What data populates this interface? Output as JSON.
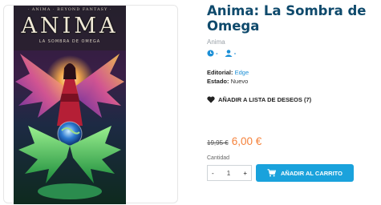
{
  "product": {
    "title": "Anima: La Sombra de Omega",
    "subtitle": "Anima",
    "cover": {
      "top_line": "· ANIMA · BEYOND FANTASY ·",
      "title": "ANIMA",
      "subtitle": "LA SOMBRA DE OMEGA"
    },
    "meta": {
      "clock_value": "-",
      "players_value": "-"
    },
    "details": {
      "editorial_label": "Editorial:",
      "editorial_value": "Edge",
      "estado_label": "Estado:",
      "estado_value": "Nuevo"
    },
    "wishlist_label": "AÑADIR A LISTA DE DESEOS (7)",
    "price": {
      "old": "19,95 €",
      "new": "6,00 €"
    },
    "quantity": {
      "label": "Cantidad",
      "value": "1",
      "minus": "-",
      "plus": "+"
    },
    "add_to_cart_label": "AÑADIR AL CARRITO"
  },
  "colors": {
    "title": "#0f4a6c",
    "accent": "#1aa2dc",
    "price": "#f5823b"
  }
}
